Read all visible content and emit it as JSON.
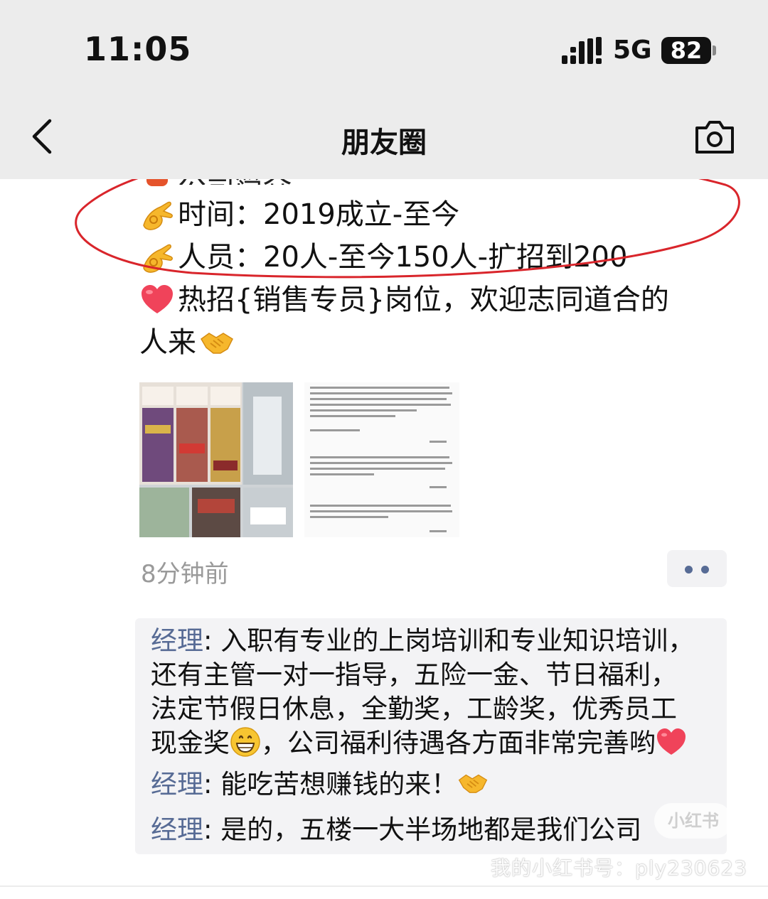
{
  "status_bar": {
    "time": "11:05",
    "network": "5G",
    "battery": "82"
  },
  "nav": {
    "title": "朋友圈",
    "back_icon": "chevron-left-icon",
    "camera_icon": "camera-icon"
  },
  "post": {
    "partial_line": "公司简介",
    "lines": [
      {
        "emoji": "ok-hand-icon",
        "text": "时间：2019成立-至今"
      },
      {
        "emoji": "ok-hand-icon",
        "text": "人员：20人-至今150人-扩招到200"
      },
      {
        "emoji": "heart-icon",
        "text": "热招{销售专员}岗位，欢迎志同道合的"
      },
      {
        "emoji": "",
        "text": "人来"
      }
    ],
    "time_ago": "8分钟前"
  },
  "comments": [
    {
      "author": "经理",
      "text_a": "入职有专业的上岗培训和专业知识培训，",
      "text_b": "还有主管一对一指导，五险一金、节日福利，",
      "text_c": "法定节假日休息，全勤奖，工龄奖，优秀员工",
      "text_d": "现金奖",
      "text_e": "，公司福利待遇各方面非常完善哟"
    },
    {
      "author": "经理",
      "text": "能吃苦想赚钱的来！"
    },
    {
      "author": "经理",
      "text": "是的，五楼一大半场地都是我们公司"
    }
  ],
  "watermark": {
    "badge": "小红书",
    "text": "我的小红书号：ply230623"
  },
  "colors": {
    "name_blue": "#576b95",
    "annotation_red": "#d9252b",
    "bar_gray": "#ececec"
  }
}
